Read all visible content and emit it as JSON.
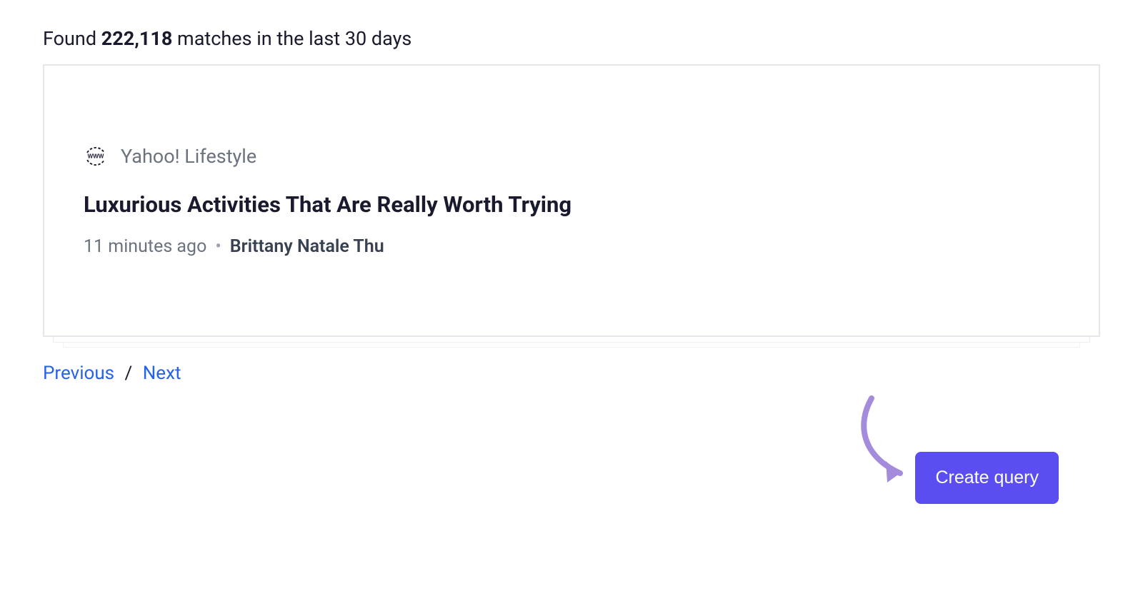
{
  "summary": {
    "prefix": "Found ",
    "count": "222,118",
    "suffix": " matches in the last 30 days"
  },
  "result": {
    "source": "Yahoo! Lifestyle",
    "title": "Luxurious Activities That Are Really Worth Trying",
    "time_ago": "11 minutes ago",
    "author": "Brittany Natale Thu"
  },
  "pagination": {
    "previous": "Previous",
    "next": "Next"
  },
  "cta": {
    "create_query": "Create query"
  },
  "colors": {
    "accent": "#5b4ef0",
    "link": "#2563eb",
    "arrow": "#a58bdc"
  }
}
